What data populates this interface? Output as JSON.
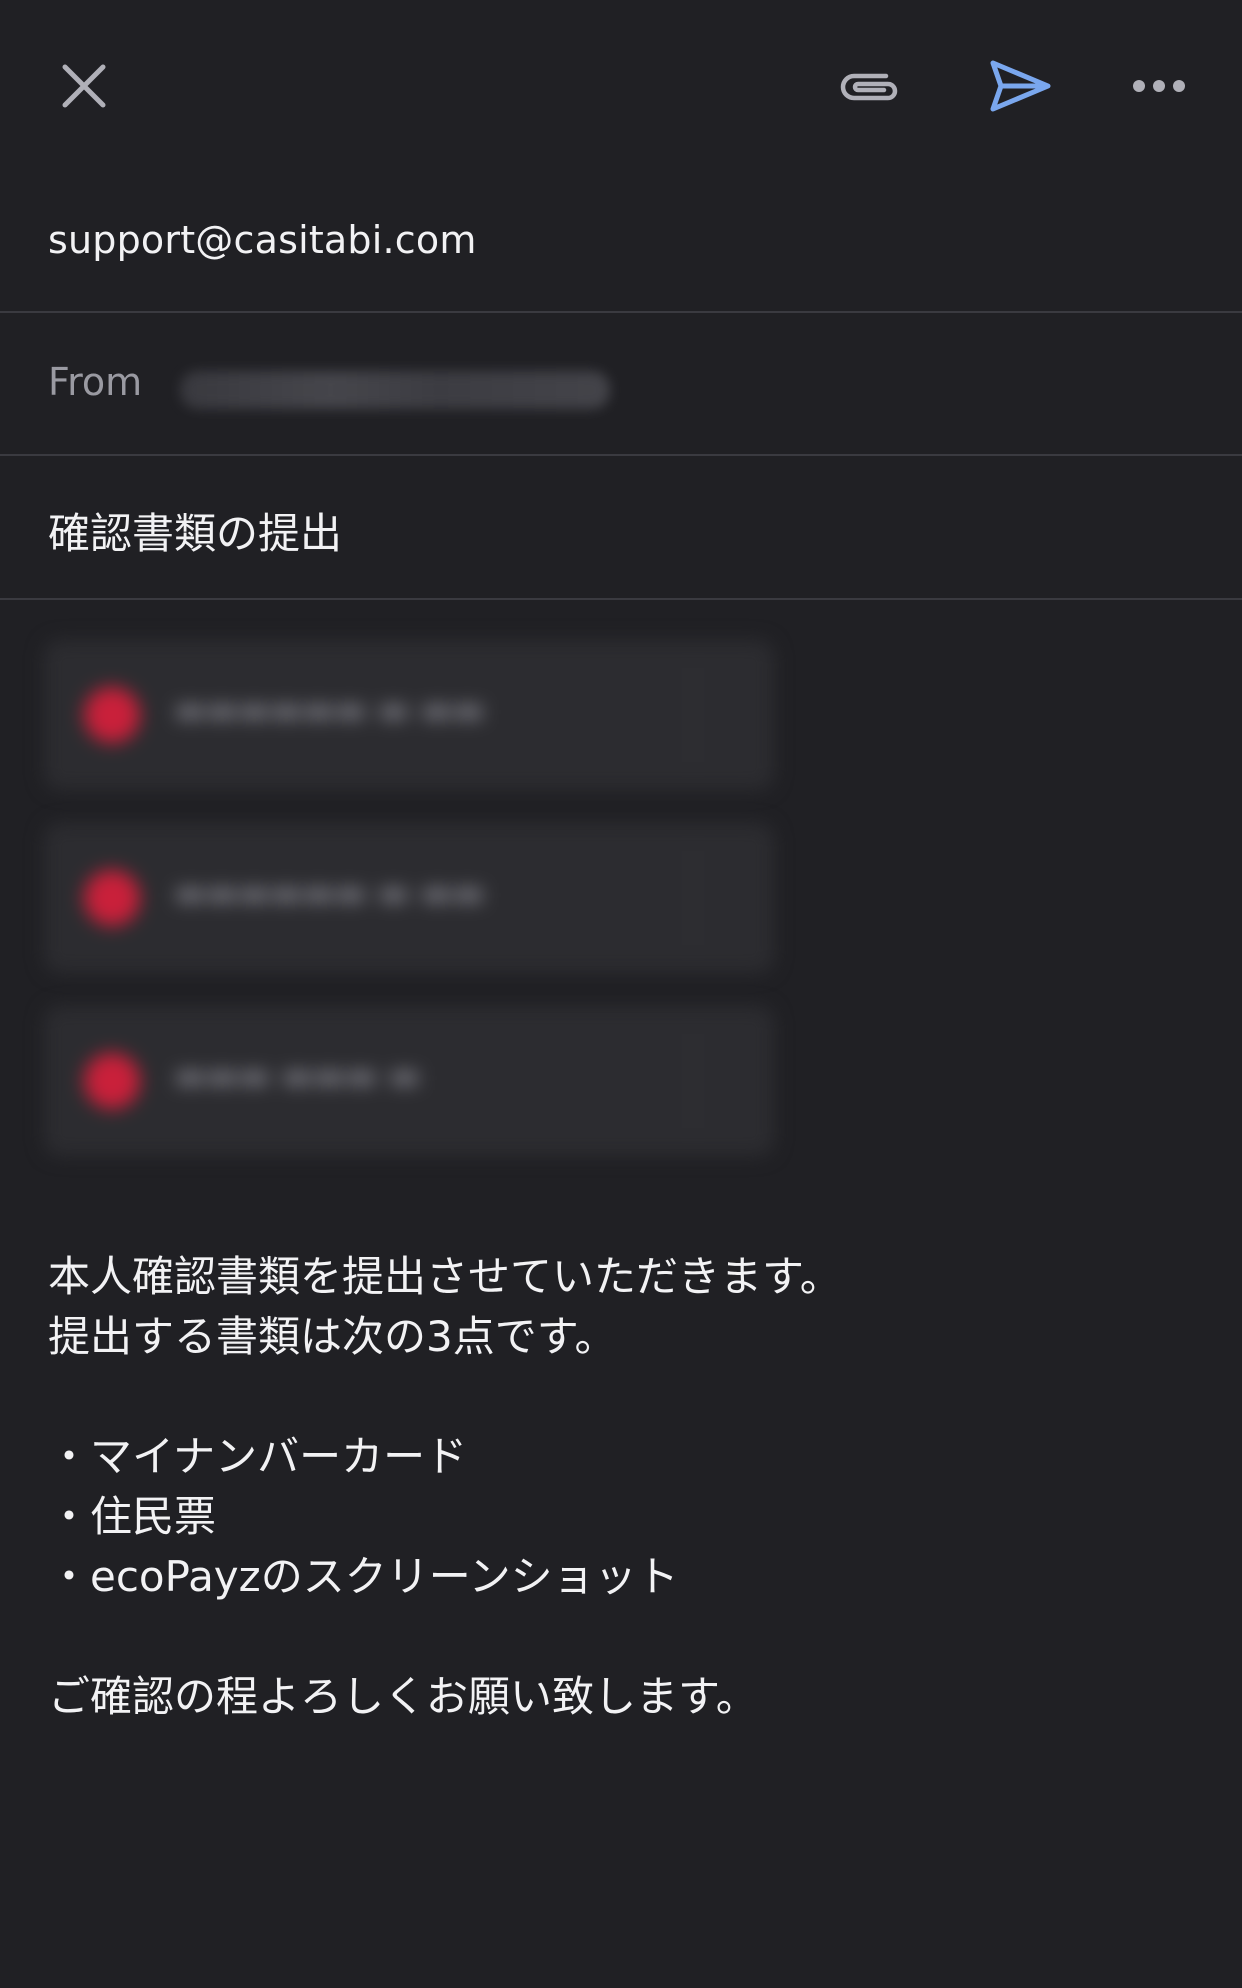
{
  "toolbar": {
    "close_icon": "close-icon",
    "attach_icon": "paperclip-icon",
    "send_icon": "send-icon",
    "more_icon": "more-horizontal-icon",
    "send_color": "#7aa7ee"
  },
  "compose": {
    "to": "support@casitabi.com",
    "from_label": "From",
    "subject": "確認書類の提出"
  },
  "body": {
    "lines": [
      "本人確認書類を提出させていただきます。",
      "提出する書類は次の3点です。",
      "",
      "・マイナンバーカード",
      "・住民票",
      "・ecoPayzのスクリーンショット",
      "",
      "ご確認の程よろしくお願い致します。"
    ]
  },
  "colors": {
    "background": "#202024",
    "text": "#f2f2f4",
    "secondary_text": "#9a9aa2",
    "divider": "#3a3a40",
    "attachment_icon": "#c9203a"
  }
}
